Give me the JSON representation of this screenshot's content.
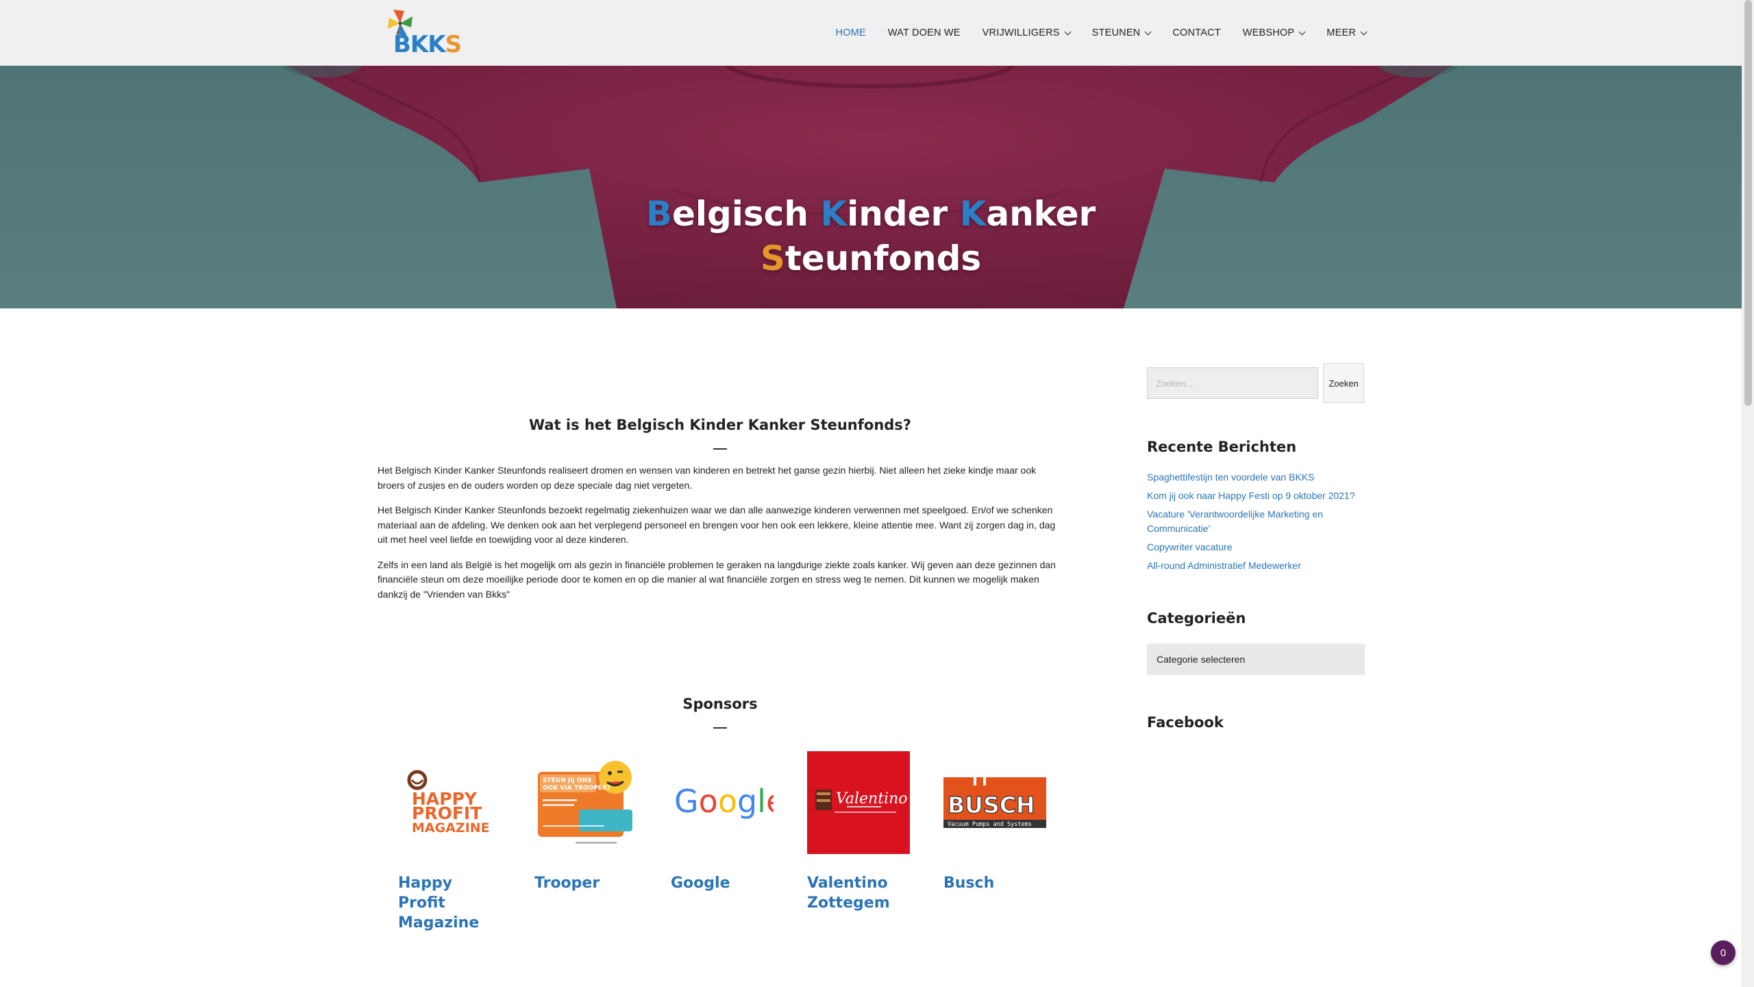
{
  "header": {
    "logo_text": "BKKS",
    "nav": [
      {
        "label": "HOME",
        "dropdown": false,
        "active": true
      },
      {
        "label": "WAT DOEN WE",
        "dropdown": false,
        "active": false
      },
      {
        "label": "VRIJWILLIGERS",
        "dropdown": true,
        "active": false
      },
      {
        "label": "STEUNEN",
        "dropdown": true,
        "active": false
      },
      {
        "label": "CONTACT",
        "dropdown": false,
        "active": false
      },
      {
        "label": "WEBSHOP",
        "dropdown": true,
        "active": false
      },
      {
        "label": "MEER",
        "dropdown": true,
        "active": false
      }
    ]
  },
  "hero": {
    "line1": [
      {
        "first": "B",
        "rest": "elgisch "
      },
      {
        "first": "K",
        "rest": "inder "
      },
      {
        "first": "K",
        "rest": "anker"
      }
    ],
    "line2": {
      "first": "S",
      "rest": "teunfonds"
    }
  },
  "intro": {
    "title": "Wat is het Belgisch Kinder Kanker Steunfonds?",
    "paragraphs": [
      "Het Belgisch Kinder Kanker Steunfonds realiseert dromen en wensen van kinderen en betrekt het ganse gezin hierbij. Niet alleen het zieke kindje maar ook broers of zusjes en de ouders worden op deze speciale dag niet vergeten.",
      "Het Belgisch Kinder Kanker Steunfonds bezoekt regelmatig ziekenhuizen waar we dan alle aanwezige kinderen verwennen met speelgoed. En/of we schenken materiaal aan de afdeling. We denken ook aan het verplegend personeel en brengen voor hen ook een lekkere, kleine attentie mee. Want zij zorgen dag in, dag uit met heel veel liefde en toewijding voor al deze kinderen.",
      "Zelfs in een land als België is het mogelijk om als gezin in financiële problemen te geraken na langdurige ziekte zoals kanker. Wij geven aan deze gezinnen dan financiële steun om deze moeilijke periode door te komen en op die manier al wat financiële zorgen en stress weg te nemen. Dit kunnen we mogelijk maken dankzij de \"Vrienden van Bkks\""
    ]
  },
  "sponsors": {
    "title": "Sponsors",
    "items": [
      {
        "name": "Happy Profit Magazine",
        "logo_lines": [
          "HAPPY",
          "PROFIT",
          "MAGAZINE"
        ]
      },
      {
        "name": "Trooper",
        "logo_lines": [
          "STEUN JIJ ONS",
          "OOK VIA TROOPER?"
        ]
      },
      {
        "name": "Google",
        "logo_letters": [
          "G",
          "o",
          "o",
          "g",
          "l",
          "e"
        ]
      },
      {
        "name": "Valentino Zottegem",
        "logo_lines": [
          "Valentino"
        ]
      },
      {
        "name": "Busch",
        "logo_lines": [
          "BUSCH",
          "Vacuum Pumps and Systems"
        ]
      }
    ]
  },
  "sidebar": {
    "search_placeholder": "Zoeken...",
    "search_button": "Zoeken",
    "recent_title": "Recente Berichten",
    "recent_posts": [
      "Spaghettifestijn ten voordele van BKKS",
      "Kom jij ook naar Happy Festi op 9 oktober 2021?",
      "Vacature 'Verantwoordelijke Marketing en Communicatie'",
      "Copywriter vacature",
      "All-round Administratief Medewerker"
    ],
    "categories_title": "Categorieën",
    "categories_select": "Categorie selecteren",
    "facebook_title": "Facebook"
  },
  "cart": {
    "count": "0"
  },
  "colors": {
    "link_blue": "#2a74b5",
    "hero_blue": "#2a7fc6",
    "hero_orange": "#e8952b",
    "badge_purple": "#5a1e5c"
  }
}
